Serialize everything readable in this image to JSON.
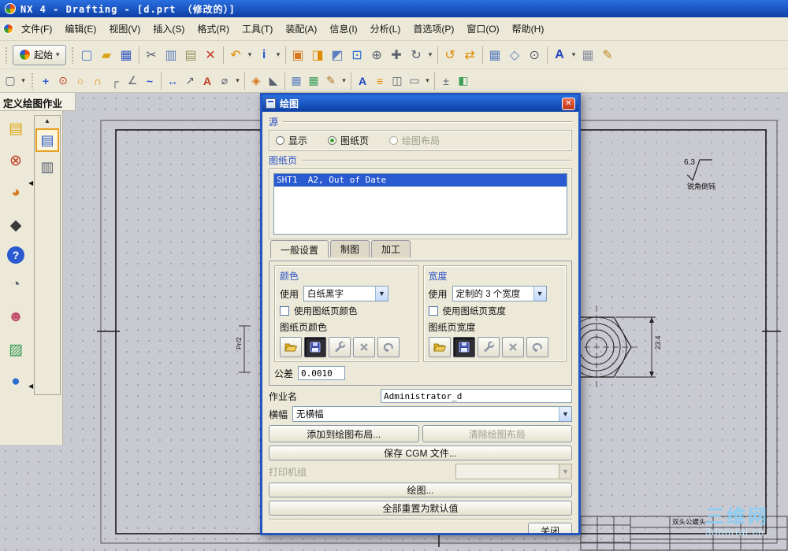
{
  "window": {
    "title": "NX 4 - Drafting - [d.prt （修改的）]"
  },
  "menu": {
    "items": [
      "文件(F)",
      "编辑(E)",
      "视图(V)",
      "插入(S)",
      "格式(R)",
      "工具(T)",
      "装配(A)",
      "信息(I)",
      "分析(L)",
      "首选项(P)",
      "窗口(O)",
      "帮助(H)"
    ]
  },
  "toolbar_main": {
    "start_label": "起始",
    "icons": [
      {
        "t": "grip"
      },
      {
        "t": "start"
      },
      {
        "t": "grip"
      },
      {
        "n": "new-file-icon",
        "g": "▢",
        "c": "#4a78c8"
      },
      {
        "n": "open-folder-icon",
        "g": "▰",
        "c": "#dca61a"
      },
      {
        "n": "save-icon",
        "g": "▦",
        "c": "#3558c0"
      },
      {
        "t": "sep"
      },
      {
        "n": "cut-icon",
        "g": "✂",
        "c": "#5a6270"
      },
      {
        "n": "copy-icon",
        "g": "▥",
        "c": "#5b7fc0"
      },
      {
        "n": "paste-icon",
        "g": "▤",
        "c": "#98905e"
      },
      {
        "n": "delete-icon",
        "g": "✕",
        "c": "#c43b28"
      },
      {
        "t": "sep"
      },
      {
        "n": "undo-icon",
        "g": "↶",
        "c": "#e08a00"
      },
      {
        "t": "dd"
      },
      {
        "n": "info-cursor-icon",
        "g": "i",
        "c": "#2a5ad0",
        "bold": true
      },
      {
        "t": "dd"
      },
      {
        "t": "sep"
      },
      {
        "n": "window-layout-icon",
        "g": "▣",
        "c": "#d87820"
      },
      {
        "n": "display-mode-icon",
        "g": "◨",
        "c": "#e08a00"
      },
      {
        "n": "show-hide-icon",
        "g": "◩",
        "c": "#5b7fc0"
      },
      {
        "n": "zoom-window-icon",
        "g": "⊡",
        "c": "#2a6fd0"
      },
      {
        "n": "zoom-icon",
        "g": "⊕",
        "c": "#5a6270"
      },
      {
        "n": "pan-icon",
        "g": "✚",
        "c": "#5a6270"
      },
      {
        "n": "rotate-view-icon",
        "g": "↻",
        "c": "#5a6270"
      },
      {
        "t": "dd"
      },
      {
        "t": "sep"
      },
      {
        "n": "refresh-icon",
        "g": "↺",
        "c": "#e08a00"
      },
      {
        "n": "update-display-icon",
        "g": "⇄",
        "c": "#e08a00"
      },
      {
        "t": "sep"
      },
      {
        "n": "snap-grid-icon",
        "g": "▦",
        "c": "#5b7fc0"
      },
      {
        "n": "work-plane-icon",
        "g": "◇",
        "c": "#5b7fc0"
      },
      {
        "n": "point-snap-icon",
        "g": "⊙",
        "c": "#5a6270"
      },
      {
        "t": "sep"
      },
      {
        "n": "text-tool-icon",
        "g": "A",
        "c": "#2244c0",
        "bold": true
      },
      {
        "t": "dd"
      },
      {
        "n": "grid-display-icon",
        "g": "▦",
        "c": "#8890a0"
      },
      {
        "n": "sketch-icon",
        "g": "✎",
        "c": "#c08a20"
      }
    ]
  },
  "toolbar_second": {
    "icons": [
      {
        "n": "sheet-new-icon",
        "g": "▢",
        "c": "#5a6270"
      },
      {
        "t": "dd"
      },
      {
        "t": "grip"
      },
      {
        "n": "datum-icon",
        "g": "+",
        "c": "#2a5ad0",
        "bold": true
      },
      {
        "n": "point-icon",
        "g": "⊙",
        "c": "#c03a20"
      },
      {
        "n": "circle-icon",
        "g": "○",
        "c": "#e08a00"
      },
      {
        "n": "arc-icon",
        "g": "∩",
        "c": "#e08a00"
      },
      {
        "n": "profile-icon",
        "g": "┌",
        "c": "#5a6270"
      },
      {
        "n": "chamfer-icon",
        "g": "∠",
        "c": "#5a6270"
      },
      {
        "n": "spline-icon",
        "g": "~",
        "c": "#2a5ad0",
        "bold": true
      },
      {
        "t": "sep"
      },
      {
        "n": "dimension-icon",
        "g": "↔",
        "c": "#2a5ad0"
      },
      {
        "n": "leader-icon",
        "g": "↗",
        "c": "#5a6270"
      },
      {
        "n": "note-icon",
        "g": "A",
        "c": "#c03a20",
        "bold": true
      },
      {
        "n": "diameter-symbol-icon",
        "g": "⌀",
        "c": "#5a6270"
      },
      {
        "t": "dd"
      },
      {
        "t": "sep"
      },
      {
        "n": "id-symbol-icon",
        "g": "◈",
        "c": "#d87820"
      },
      {
        "n": "weld-symbol-icon",
        "g": "◣",
        "c": "#5a6270"
      },
      {
        "t": "sep"
      },
      {
        "n": "view-table-icon",
        "g": "▦",
        "c": "#5b7fc0"
      },
      {
        "n": "parts-list-icon",
        "g": "▦",
        "c": "#3a9d58"
      },
      {
        "n": "edit-table-icon",
        "g": "✎",
        "c": "#b07020"
      },
      {
        "t": "dd"
      },
      {
        "t": "sep"
      },
      {
        "n": "annotation-style-icon",
        "g": "A",
        "c": "#2244c0",
        "bold": true
      },
      {
        "n": "align-icon",
        "g": "≡",
        "c": "#e08a00"
      },
      {
        "n": "frame-icon",
        "g": "◫",
        "c": "#5a6270"
      },
      {
        "n": "margins-icon",
        "g": "▭",
        "c": "#5a6270"
      },
      {
        "t": "dd"
      },
      {
        "t": "sep"
      },
      {
        "n": "tolerance-icon",
        "g": "±",
        "c": "#5a6270"
      },
      {
        "n": "layer-icon",
        "g": "◧",
        "c": "#3a9d58"
      }
    ]
  },
  "left_outer_strip": {
    "icons": [
      {
        "n": "roles-icon",
        "g": "▤",
        "c": "#e0a810"
      },
      {
        "n": "assembly-navigator-icon",
        "g": "⊗",
        "c": "#c03a20"
      },
      {
        "n": "part-navigator-icon",
        "g": "◕",
        "c": "#d87820"
      },
      {
        "n": "training-icon",
        "g": "◆",
        "c": "#3a3a3a"
      },
      {
        "n": "help-icon",
        "g": "?",
        "c": "#ffffff",
        "help": true
      },
      {
        "n": "history-icon",
        "g": "◔",
        "c": "#5a6270"
      },
      {
        "n": "contacts-icon",
        "g": "☻",
        "c": "#c04a6a"
      },
      {
        "n": "palette-icon",
        "g": "▨",
        "c": "#3a9d58"
      },
      {
        "n": "web-browser-icon",
        "g": "●",
        "c": "#2a6fd0"
      }
    ]
  },
  "left_inner_strip": {
    "icons": [
      {
        "n": "plot-job-icon",
        "g": "▤",
        "c": "#2a5ad0",
        "active": true
      },
      {
        "n": "plot-queue-icon",
        "g": "▥",
        "c": "#5a6270"
      }
    ]
  },
  "cue": {
    "label": "定义绘图作业"
  },
  "dialog": {
    "title": "绘图",
    "close_glyph": "✕",
    "source": {
      "label": "源",
      "options": [
        {
          "label": "显示",
          "checked": false,
          "disabled": false
        },
        {
          "label": "图纸页",
          "checked": true,
          "disabled": false
        },
        {
          "label": "绘图布局",
          "checked": false,
          "disabled": true
        }
      ]
    },
    "sheet": {
      "label": "图纸页",
      "items": [
        "SHT1  A2, Out of Date"
      ],
      "selected_index": 0
    },
    "tabs": [
      "一般设置",
      "制图",
      "加工"
    ],
    "active_tab": 0,
    "color": {
      "label": "颜色",
      "use_label": "使用",
      "use_value": "白纸黑字",
      "checkbox_label": "使用图纸页颜色",
      "sheet_color_label": "图纸页颜色"
    },
    "width": {
      "label": "宽度",
      "use_label": "使用",
      "use_value": "定制的 3 个宽度",
      "checkbox_label": "使用图纸页宽度",
      "sheet_width_label": "图纸页宽度"
    },
    "tolerance": {
      "label": "公差",
      "value": "0.0010"
    },
    "job_name": {
      "label": "作业名",
      "value": "Administrator_d"
    },
    "banner": {
      "label": "横幅",
      "value": "无横幅"
    },
    "printer": {
      "label": "打印机组",
      "value": ""
    },
    "buttons": {
      "add_layout": "添加到绘图布局...",
      "clear_layout": "清除绘图布局",
      "save_cgm": "保存 CGM 文件...",
      "plot": "绘图...",
      "reset": "全部重置为默认值",
      "close": "关闭"
    }
  },
  "canvas": {
    "surface_note": {
      "value": "6.3",
      "label": "锐角倒钝"
    },
    "dim_right": "23.4",
    "dim_left": "Pr/2",
    "title_block_text": "双头公螺头一",
    "watermark": {
      "line1": "三维网",
      "line2": "3dportal.cn"
    }
  },
  "colors": {
    "titlebar_blue": "#1a63d6",
    "dialog_beige": "#ece9d8",
    "selection_blue": "#2a5ad0",
    "group_label_blue": "#2b50c8",
    "canvas_gray": "#c9c9d1"
  }
}
